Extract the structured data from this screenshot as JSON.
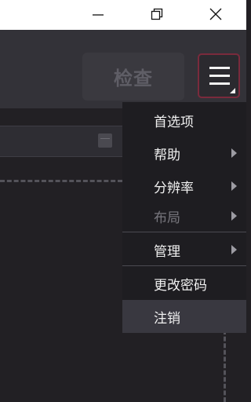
{
  "window": {
    "minimize_icon": "minimize-icon",
    "restore_icon": "restore-icon",
    "close_icon": "close-icon"
  },
  "toolbar": {
    "inspect_label": "检查",
    "menu_icon": "hamburger-menu-icon"
  },
  "menu": {
    "items": [
      {
        "label": "首选项",
        "has_submenu": false
      },
      {
        "label": "帮助",
        "has_submenu": true
      },
      {
        "label": "分辨率",
        "has_submenu": true
      },
      {
        "label": "布局",
        "has_submenu": true,
        "disabled": true
      },
      {
        "label": "管理",
        "has_submenu": true
      },
      {
        "label": "更改密码",
        "has_submenu": false
      },
      {
        "label": "注销",
        "has_submenu": false,
        "highlighted": true
      }
    ]
  },
  "colors": {
    "background": "#222024",
    "toolbar": "#333238",
    "menu_background": "#1e1d21",
    "menu_button_border": "#7a2a3c",
    "highlight": "#393840"
  }
}
